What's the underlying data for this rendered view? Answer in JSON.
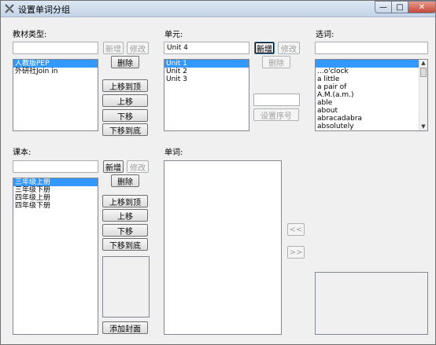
{
  "window": {
    "title": "设置单词分组",
    "min_glyph": "—",
    "max_glyph": "□",
    "close_glyph": "✕"
  },
  "textbook_type": {
    "label": "教材类型:",
    "input_value": "",
    "add_label": "新增",
    "edit_label": "修改",
    "delete_label": "删除",
    "items": [
      "人教版PEP",
      "外研社Join in"
    ],
    "selected_index": 0,
    "move_top_label": "上移到顶",
    "move_up_label": "上移",
    "move_down_label": "下移",
    "move_bottom_label": "下移到底"
  },
  "unit": {
    "label": "单元:",
    "input_value": "Unit 4",
    "add_label": "新增",
    "edit_label": "修改",
    "delete_label": "删除",
    "items": [
      "Unit 1",
      "Unit 2",
      "Unit 3"
    ],
    "selected_index": 0,
    "order_input_value": "",
    "set_order_label": "设置序号"
  },
  "select_word": {
    "label": "选词:",
    "input_value": "",
    "items": [
      "",
      "...o'clock",
      "a little",
      "a pair of",
      "A.M.(a.m.)",
      "able",
      "about",
      "abracadabra",
      "absolutely"
    ],
    "selected_index": 0
  },
  "textbook": {
    "label": "课本:",
    "input_value": "",
    "add_label": "新增",
    "edit_label": "修改",
    "delete_label": "删除",
    "items": [
      "三年级上册",
      "三年级下册",
      "四年级上册",
      "四年级下册"
    ],
    "selected_index": 0,
    "move_top_label": "上移到顶",
    "move_up_label": "上移",
    "move_down_label": "下移",
    "move_bottom_label": "下移到底",
    "add_cover_label": "添加封面"
  },
  "words": {
    "label": "单词:",
    "items": [],
    "add_label": "<<",
    "remove_label": ">>"
  }
}
